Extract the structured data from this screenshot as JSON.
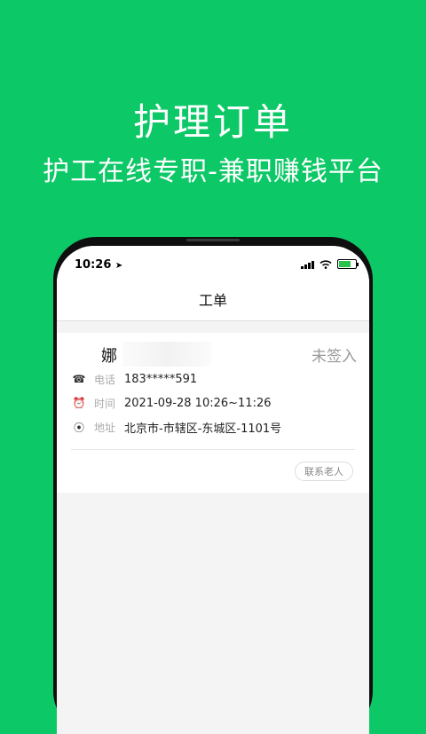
{
  "promo": {
    "headline": "护理订单",
    "subline": "护工在线专职-兼职赚钱平台"
  },
  "status_bar": {
    "time": "10:26",
    "location_icon": "➤"
  },
  "nav": {
    "title": "工单"
  },
  "order": {
    "name": "娜",
    "status": "未签入",
    "phone_label": "电话",
    "phone_value": "183*****591",
    "time_label": "时间",
    "time_value": "2021-09-28 10:26~11:26",
    "address_label": "地址",
    "address_value": "北京市-市辖区-东城区-1101号",
    "contact_button": "联系老人"
  },
  "icons": {
    "phone": "☎",
    "clock": "⏰",
    "pin": "⦿"
  },
  "colors": {
    "brand_green": "#0cc866",
    "battery_green": "#2ac24a"
  }
}
